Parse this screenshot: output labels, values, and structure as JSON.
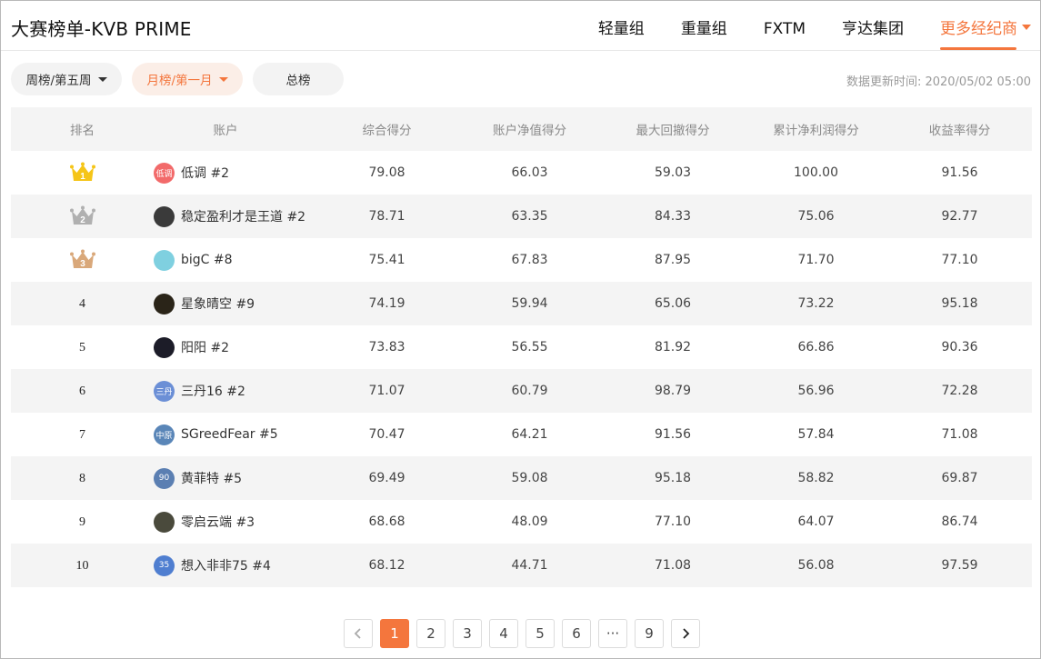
{
  "header": {
    "title": "大赛榜单-KVB PRIME",
    "tabs": [
      {
        "label": "轻量组",
        "active": false
      },
      {
        "label": "重量组",
        "active": false
      },
      {
        "label": "FXTM",
        "active": false
      },
      {
        "label": "亨达集团",
        "active": false
      },
      {
        "label": "更多经纪商",
        "active": true
      }
    ]
  },
  "filters": {
    "week": "周榜/第五周",
    "month": "月榜/第一月",
    "total": "总榜",
    "updated": "数据更新时间: 2020/05/02 05:00"
  },
  "table": {
    "columns": [
      "排名",
      "账户",
      "综合得分",
      "账户净值得分",
      "最大回撤得分",
      "累计净利润得分",
      "收益率得分"
    ],
    "rows": [
      {
        "rank": "1",
        "avatar": "低调",
        "avatar_color": "#f26a6a",
        "account": "低调 #2",
        "total": "79.08",
        "equity": "66.03",
        "drawdown": "59.03",
        "profit": "100.00",
        "return": "91.56"
      },
      {
        "rank": "2",
        "avatar": "",
        "avatar_color": "#3a3a3a",
        "account": "稳定盈利才是王道 #2",
        "total": "78.71",
        "equity": "63.35",
        "drawdown": "84.33",
        "profit": "75.06",
        "return": "92.77"
      },
      {
        "rank": "3",
        "avatar": "",
        "avatar_color": "#7fd0e0",
        "account": "bigC #8",
        "total": "75.41",
        "equity": "67.83",
        "drawdown": "87.95",
        "profit": "71.70",
        "return": "77.10"
      },
      {
        "rank": "4",
        "avatar": "",
        "avatar_color": "#2a2418",
        "account": "星象晴空 #9",
        "total": "74.19",
        "equity": "59.94",
        "drawdown": "65.06",
        "profit": "73.22",
        "return": "95.18"
      },
      {
        "rank": "5",
        "avatar": "",
        "avatar_color": "#1c1c28",
        "account": "阳阳 #2",
        "total": "73.83",
        "equity": "56.55",
        "drawdown": "81.92",
        "profit": "66.86",
        "return": "90.36"
      },
      {
        "rank": "6",
        "avatar": "三丹",
        "avatar_color": "#6b8fd6",
        "account": "三丹16 #2",
        "total": "71.07",
        "equity": "60.79",
        "drawdown": "98.79",
        "profit": "56.96",
        "return": "72.28"
      },
      {
        "rank": "7",
        "avatar": "中原",
        "avatar_color": "#5a86b8",
        "account": "SGreedFear #5",
        "total": "70.47",
        "equity": "64.21",
        "drawdown": "91.56",
        "profit": "57.84",
        "return": "71.08"
      },
      {
        "rank": "8",
        "avatar": "90",
        "avatar_color": "#5b7fb2",
        "account": "黄菲特 #5",
        "total": "69.49",
        "equity": "59.08",
        "drawdown": "95.18",
        "profit": "58.82",
        "return": "69.87"
      },
      {
        "rank": "9",
        "avatar": "",
        "avatar_color": "#4a4a3c",
        "account": "零启云端 #3",
        "total": "68.68",
        "equity": "48.09",
        "drawdown": "77.10",
        "profit": "64.07",
        "return": "86.74"
      },
      {
        "rank": "10",
        "avatar": "35",
        "avatar_color": "#4f7ed0",
        "account": "想入非非75 #4",
        "total": "68.12",
        "equity": "44.71",
        "drawdown": "71.08",
        "profit": "56.08",
        "return": "97.59"
      }
    ]
  },
  "pagination": {
    "pages": [
      "1",
      "2",
      "3",
      "4",
      "5",
      "6",
      "···",
      "9"
    ],
    "current": "1",
    "prev_icon": "chevron-left-icon",
    "next_icon": "chevron-right-icon"
  },
  "colors": {
    "accent": "#f4763d",
    "gold": "#f5c518",
    "silver": "#b0b0b0",
    "bronze": "#d9a87a"
  }
}
